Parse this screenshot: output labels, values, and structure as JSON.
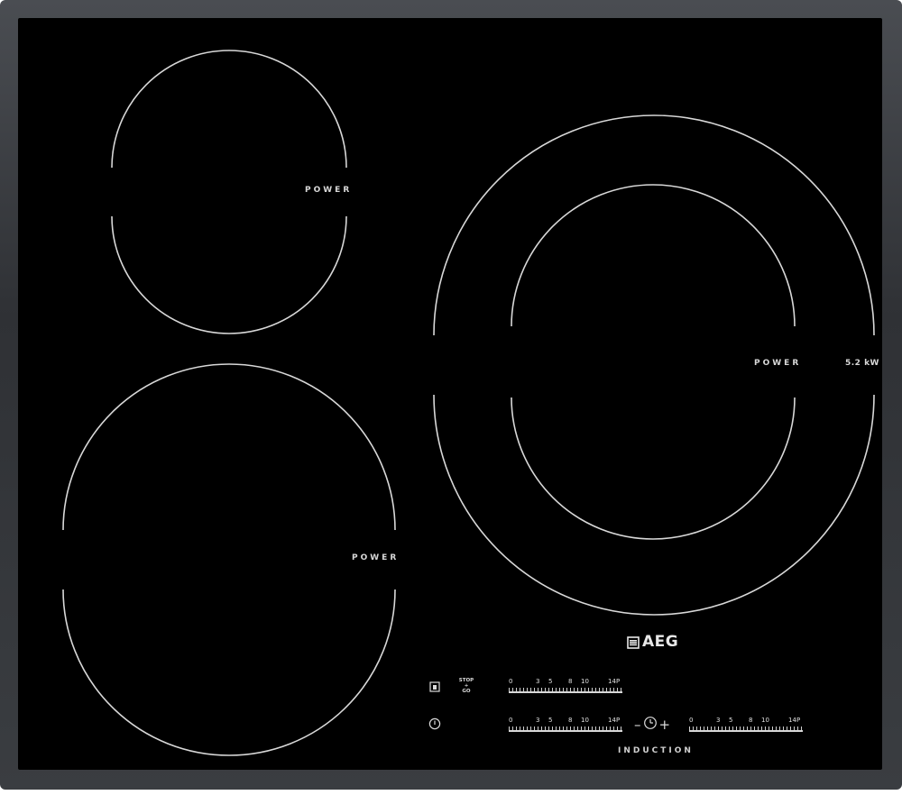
{
  "zones": {
    "top_left": {
      "label": "POWER"
    },
    "bottom_left": {
      "label": "POWER"
    },
    "right": {
      "label": "POWER",
      "rating": "5.2 kW"
    }
  },
  "brand": {
    "name": "AEG"
  },
  "controls": {
    "lock_icon": "lock-icon",
    "power_icon": "power-icon",
    "stop_go": {
      "line1": "STOP",
      "line2": "+",
      "line3": "GO"
    },
    "slider_scale": [
      "0",
      "3",
      "5",
      "8",
      "10",
      "14",
      "P"
    ],
    "timer": {
      "minus": "–",
      "plus": "+"
    }
  },
  "footer": {
    "label": "INDUCTION"
  },
  "colors": {
    "frame": "#3a3d41",
    "glass": "#000000",
    "marking": "#d8d8d8"
  }
}
